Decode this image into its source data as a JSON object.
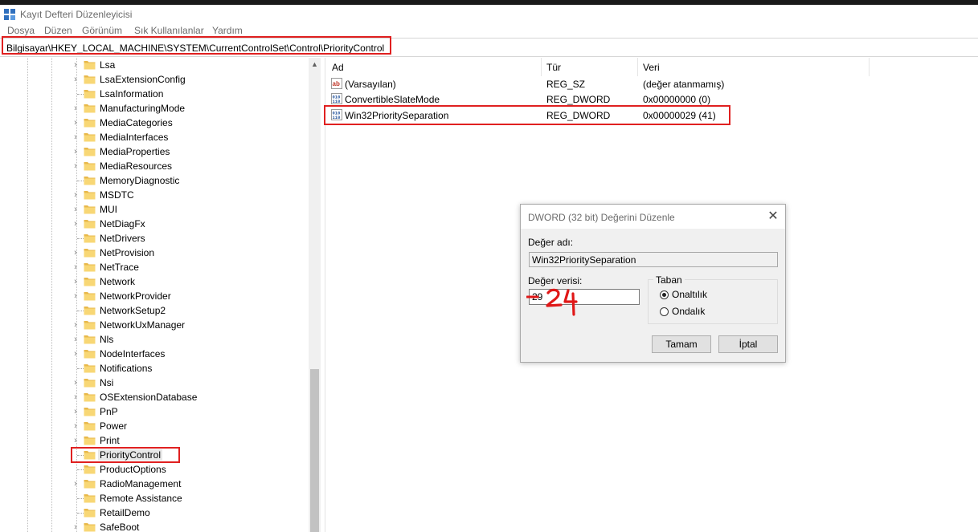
{
  "window": {
    "title": "Kayıt Defteri Düzenleyicisi"
  },
  "menu": [
    "Dosya",
    "Düzen",
    "Görünüm",
    "Sık Kullanılanlar",
    "Yardım"
  ],
  "address": "Bilgisayar\\HKEY_LOCAL_MACHINE\\SYSTEM\\CurrentControlSet\\Control\\PriorityControl",
  "tree": {
    "items": [
      {
        "label": "Lsa",
        "expandable": true
      },
      {
        "label": "LsaExtensionConfig",
        "expandable": true
      },
      {
        "label": "LsaInformation",
        "expandable": false
      },
      {
        "label": "ManufacturingMode",
        "expandable": true
      },
      {
        "label": "MediaCategories",
        "expandable": true
      },
      {
        "label": "MediaInterfaces",
        "expandable": true
      },
      {
        "label": "MediaProperties",
        "expandable": true
      },
      {
        "label": "MediaResources",
        "expandable": true
      },
      {
        "label": "MemoryDiagnostic",
        "expandable": false
      },
      {
        "label": "MSDTC",
        "expandable": true
      },
      {
        "label": "MUI",
        "expandable": true
      },
      {
        "label": "NetDiagFx",
        "expandable": true
      },
      {
        "label": "NetDrivers",
        "expandable": false
      },
      {
        "label": "NetProvision",
        "expandable": true
      },
      {
        "label": "NetTrace",
        "expandable": true
      },
      {
        "label": "Network",
        "expandable": true
      },
      {
        "label": "NetworkProvider",
        "expandable": true
      },
      {
        "label": "NetworkSetup2",
        "expandable": false
      },
      {
        "label": "NetworkUxManager",
        "expandable": true
      },
      {
        "label": "Nls",
        "expandable": true
      },
      {
        "label": "NodeInterfaces",
        "expandable": true
      },
      {
        "label": "Notifications",
        "expandable": false
      },
      {
        "label": "Nsi",
        "expandable": true
      },
      {
        "label": "OSExtensionDatabase",
        "expandable": true
      },
      {
        "label": "PnP",
        "expandable": true
      },
      {
        "label": "Power",
        "expandable": true
      },
      {
        "label": "Print",
        "expandable": true
      },
      {
        "label": "PriorityControl",
        "expandable": false,
        "selected": true
      },
      {
        "label": "ProductOptions",
        "expandable": false
      },
      {
        "label": "RadioManagement",
        "expandable": true
      },
      {
        "label": "Remote Assistance",
        "expandable": false
      },
      {
        "label": "RetailDemo",
        "expandable": false
      },
      {
        "label": "SafeBoot",
        "expandable": true
      }
    ]
  },
  "list": {
    "columns": [
      "Ad",
      "Tür",
      "Veri"
    ],
    "rows": [
      {
        "icon": "string-value-icon",
        "name": "(Varsayılan)",
        "type": "REG_SZ",
        "data": "(değer atanmamış)"
      },
      {
        "icon": "binary-value-icon",
        "name": "ConvertibleSlateMode",
        "type": "REG_DWORD",
        "data": "0x00000000 (0)"
      },
      {
        "icon": "binary-value-icon",
        "name": "Win32PrioritySeparation",
        "type": "REG_DWORD",
        "data": "0x00000029 (41)"
      }
    ]
  },
  "dialog": {
    "title": "DWORD (32 bit) Değerini Düzenle",
    "name_label": "Değer adı:",
    "name_value": "Win32PrioritySeparation",
    "data_label": "Değer verisi:",
    "data_value": "29",
    "base_label": "Taban",
    "radio_hex": "Onaltılık",
    "radio_dec": "Ondalık",
    "ok": "Tamam",
    "cancel": "İptal",
    "annotation": "24"
  },
  "colors": {
    "highlight": "#e02020",
    "folder": "#f8d775"
  }
}
